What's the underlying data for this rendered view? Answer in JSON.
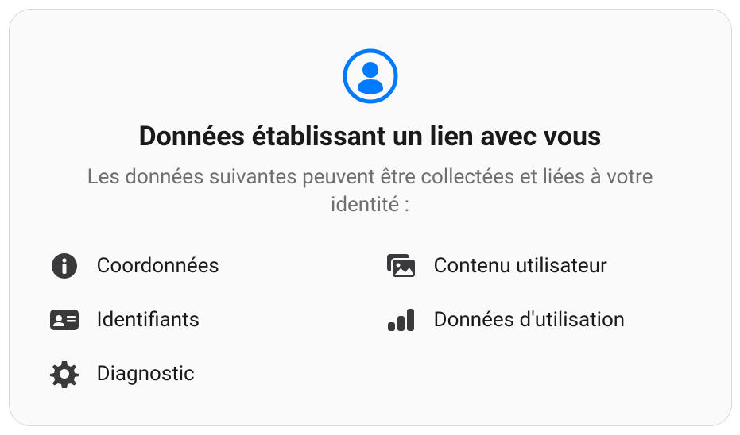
{
  "card": {
    "title": "Données établissant un lien avec vous",
    "subtitle": "Les données suivantes peuvent être collectées et liées à votre identité :",
    "items": [
      {
        "icon": "info-icon",
        "label": "Coordonnées"
      },
      {
        "icon": "photos-icon",
        "label": "Contenu utilisateur"
      },
      {
        "icon": "id-card-icon",
        "label": "Identifiants"
      },
      {
        "icon": "bars-icon",
        "label": "Données d'utilisation"
      },
      {
        "icon": "gear-icon",
        "label": "Diagnostic"
      }
    ],
    "accent_color": "#007aff"
  }
}
